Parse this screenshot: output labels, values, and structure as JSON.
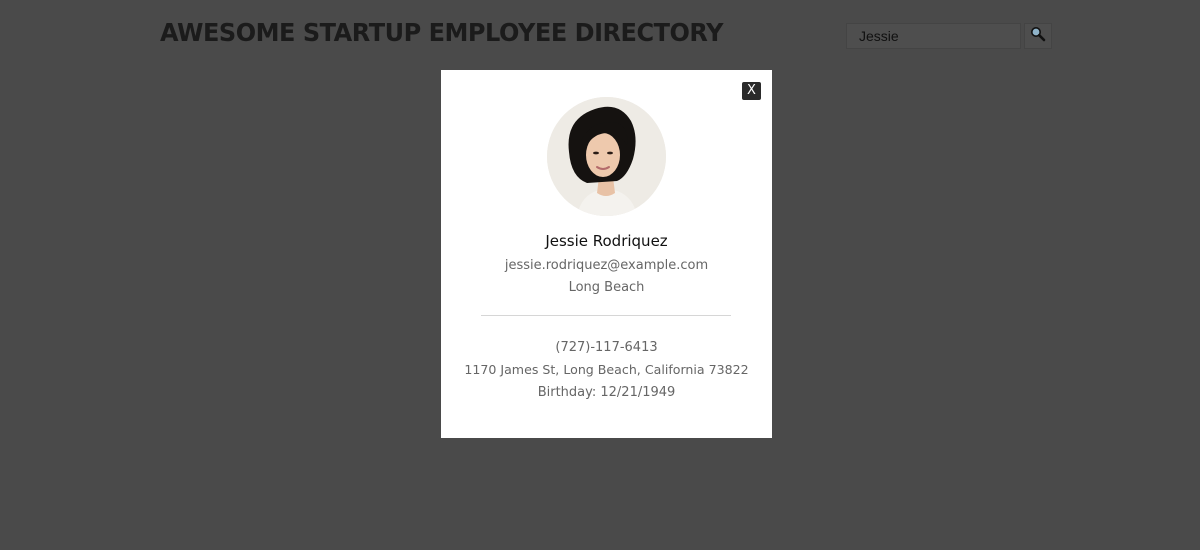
{
  "header": {
    "title": "Awesome Startup Employee Directory",
    "search": {
      "value": "Jessie",
      "button_icon": "magnifier-icon"
    }
  },
  "modal": {
    "close_label": "X",
    "employee": {
      "name": "Jessie Rodriquez",
      "email": "jessie.rodriquez@example.com",
      "city": "Long Beach",
      "phone": "(727)-117-6413",
      "address": "1170 James St, Long Beach, California 73822",
      "birthday": "Birthday: 12/21/1949"
    }
  },
  "colors": {
    "overlay_background": "#4a4a4a",
    "modal_background": "#ffffff",
    "close_button": "#2b2b2b"
  }
}
